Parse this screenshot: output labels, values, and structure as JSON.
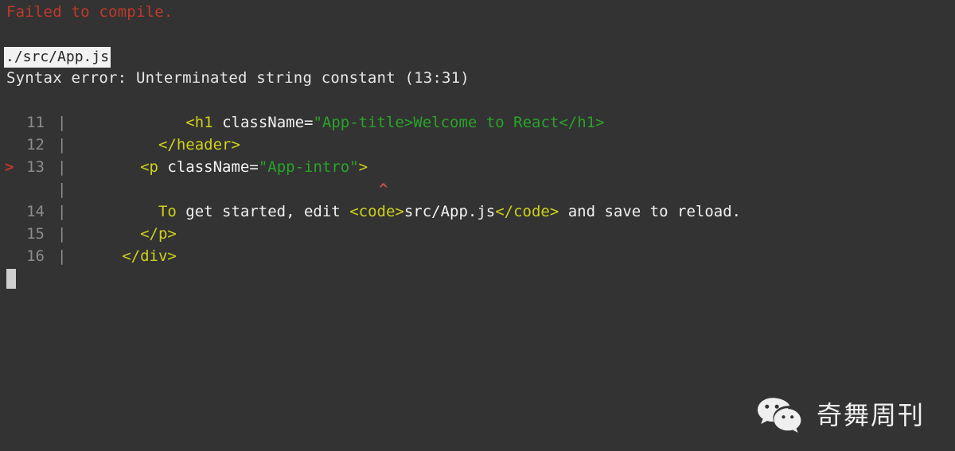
{
  "terminal": {
    "background_color": "#333333",
    "error_color": "#c0392b",
    "text_color": "#e6e6e6",
    "tag_color": "#cfd11a",
    "string_color": "#29a329",
    "lineno_color": "#8c8c8c",
    "headline": "Failed to compile.",
    "file_path": "./src/App.js",
    "error_message": "Syntax error: Unterminated string constant (13:31)"
  },
  "code": {
    "lines": [
      {
        "marker": "",
        "number": "11",
        "pipe": "|",
        "indent": "            ",
        "tokens": [
          {
            "text": "<h1",
            "type": "tag"
          },
          {
            "text": " ",
            "type": "plain"
          },
          {
            "text": "className",
            "type": "attr"
          },
          {
            "text": "=",
            "type": "eq"
          },
          {
            "text": "\"App-title>Welcome to React</h1>",
            "type": "str"
          }
        ]
      },
      {
        "marker": "",
        "number": "12",
        "pipe": "|",
        "indent": "         ",
        "tokens": [
          {
            "text": "</header>",
            "type": "tag"
          }
        ]
      },
      {
        "marker": ">",
        "number": "13",
        "pipe": "|",
        "indent": "       ",
        "tokens": [
          {
            "text": "<p",
            "type": "tag"
          },
          {
            "text": " ",
            "type": "plain"
          },
          {
            "text": "className",
            "type": "attr"
          },
          {
            "text": "=",
            "type": "eq"
          },
          {
            "text": "\"App-intro\"",
            "type": "str"
          },
          {
            "text": ">",
            "type": "tag"
          }
        ]
      },
      {
        "marker": "",
        "number": "",
        "pipe": "|",
        "indent": "",
        "caret": "^",
        "tokens": []
      },
      {
        "marker": "",
        "number": "14",
        "pipe": "|",
        "indent": "         ",
        "tokens": [
          {
            "text": "To",
            "type": "tag"
          },
          {
            "text": " get started, edit ",
            "type": "plain"
          },
          {
            "text": "<code>",
            "type": "tag"
          },
          {
            "text": "src/App.js",
            "type": "plain"
          },
          {
            "text": "</code>",
            "type": "tag"
          },
          {
            "text": " and save to reload.",
            "type": "plain"
          }
        ]
      },
      {
        "marker": "",
        "number": "15",
        "pipe": "|",
        "indent": "       ",
        "tokens": [
          {
            "text": "</p>",
            "type": "tag"
          }
        ]
      },
      {
        "marker": "",
        "number": "16",
        "pipe": "|",
        "indent": "     ",
        "tokens": [
          {
            "text": "</div>",
            "type": "tag"
          }
        ]
      }
    ]
  },
  "watermark": {
    "icon": "wechat-logo-icon",
    "label": "奇舞周刊",
    "text_color": "#f0f0f0"
  }
}
